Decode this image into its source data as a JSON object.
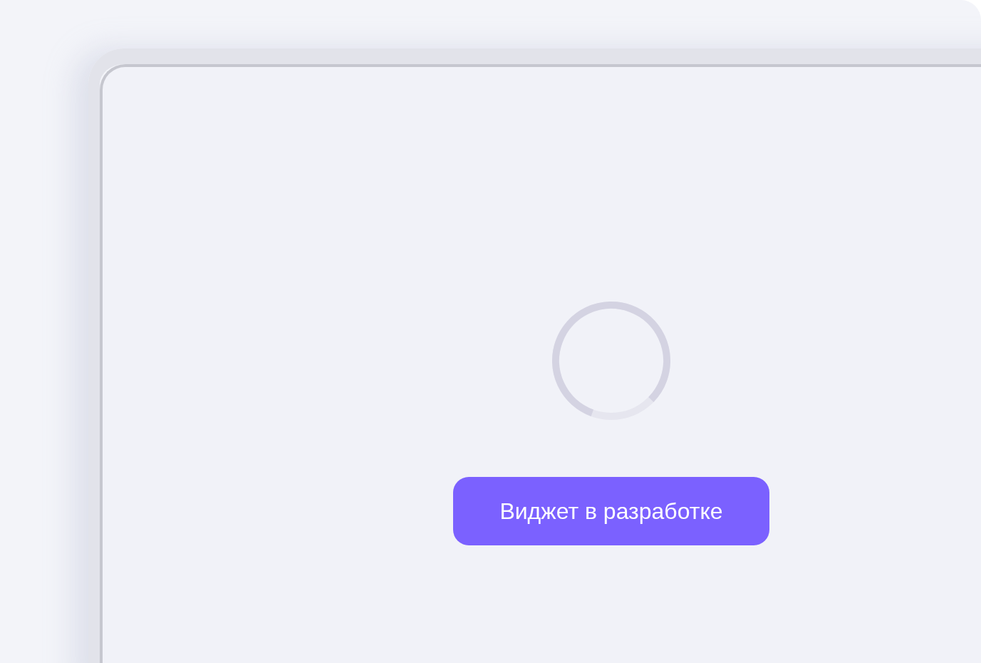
{
  "notice": {
    "label": "Виджет в разработке"
  }
}
